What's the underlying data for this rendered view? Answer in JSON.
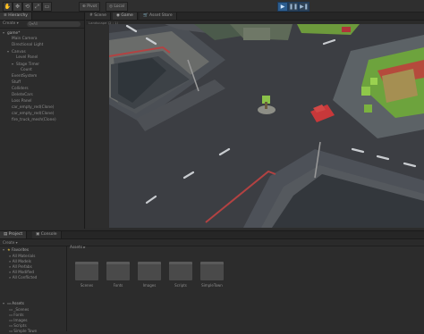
{
  "toolbar": {
    "pivot_label": "Pivot",
    "space_label": "Local",
    "tools": [
      "✋",
      "✥",
      "⟲",
      "⤢",
      "▭"
    ],
    "play_icons": [
      "▶",
      "❚❚",
      "▶❚"
    ]
  },
  "hierarchy": {
    "tab": "Hierarchy",
    "create_label": "Create ▾",
    "search_placeholder": "Q▾All",
    "items": [
      {
        "label": "game*",
        "depth": 0
      },
      {
        "label": "Main Camera",
        "depth": 1
      },
      {
        "label": "Directional Light",
        "depth": 1
      },
      {
        "label": "Canvas",
        "depth": 1
      },
      {
        "label": "Level Panel",
        "depth": 2
      },
      {
        "label": "Stage Timer",
        "depth": 2
      },
      {
        "label": "Count",
        "depth": 3
      },
      {
        "label": "EventSystem",
        "depth": 1
      },
      {
        "label": "Stuff",
        "depth": 1
      },
      {
        "label": "Colliders",
        "depth": 1
      },
      {
        "label": "DeleteCars",
        "depth": 1
      },
      {
        "label": "Loss Panel",
        "depth": 1
      },
      {
        "label": "car_empty_red(Clone)",
        "depth": 1
      },
      {
        "label": "car_empty_red(Clone)",
        "depth": 1
      },
      {
        "label": "fire_truck_mesh(Clone)",
        "depth": 1
      }
    ]
  },
  "viewport": {
    "tabs": [
      "Scene",
      "Game",
      "Asset Store"
    ],
    "aspect_label": "Landscape (2 : 1)"
  },
  "project": {
    "tabs": [
      "Project",
      "Console"
    ],
    "create_label": "Create ▾",
    "favorites_label": "Favorites",
    "favorites": [
      "All Materials",
      "All Models",
      "All Prefabs",
      "All Modified",
      "All Conflicted"
    ],
    "assets_label": "Assets",
    "asset_tree": [
      "_Scenes",
      "Fonts",
      "Images",
      "Scripts",
      "Simple Town"
    ],
    "breadcrumb": "Assets ▸",
    "folders": [
      "Scenes",
      "Fonts",
      "Images",
      "Scripts",
      "SimpleTown"
    ]
  },
  "colors": {
    "play_accent": "#2c5d8f",
    "road": "#3d3f44",
    "grass": "#7fc04a",
    "car": "#c8383a"
  }
}
